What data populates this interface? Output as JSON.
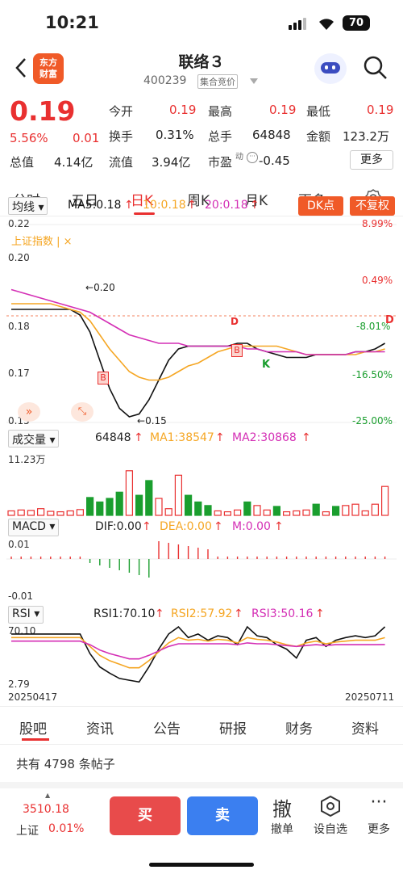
{
  "status": {
    "time": "10:21",
    "battery": "70"
  },
  "header": {
    "logo_line1": "东方",
    "logo_line2": "财富",
    "title": "联络３",
    "code": "400239",
    "auction_tag": "集合竞价"
  },
  "quote": {
    "price": "0.19",
    "pct": "5.56%",
    "change": "0.01",
    "open_lbl": "今开",
    "open": "0.19",
    "high_lbl": "最高",
    "high": "0.19",
    "low_lbl": "最低",
    "low": "0.19",
    "turnover_lbl": "换手",
    "turnover": "0.31%",
    "vol_lbl": "总手",
    "vol": "64848",
    "amount_lbl": "金额",
    "amount": "123.2万",
    "mcap_lbl": "总值",
    "mcap": "4.14亿",
    "float_lbl": "流值",
    "float": "3.94亿",
    "pe_lbl": "市盈",
    "pe_sup": "动",
    "pe": "-0.45",
    "more": "更多"
  },
  "tabs": [
    "分时",
    "五日",
    "日K",
    "周K",
    "月K",
    "更多"
  ],
  "kline": {
    "indicator": "均线",
    "ma5": "MA5:0.18",
    "ma10": "10:0.18",
    "ma20": "20:0.18",
    "dk_btn": "DK点",
    "fq_btn": "不复权",
    "overlay": "上证指数",
    "overlay_close": "×",
    "y_left": [
      "0.22",
      "0.20",
      "0.18",
      "0.17",
      "0.15"
    ],
    "y_right": [
      "8.99%",
      "0.49%",
      "-8.01%",
      "-16.50%",
      "-25.00%"
    ],
    "max_lbl": "0.20",
    "min_lbl": "0.15",
    "marker_b": "B",
    "marker_d": "D",
    "marker_k": "K",
    "right_d": "D"
  },
  "volume": {
    "indicator": "成交量",
    "vol": "64848",
    "ma1": "MA1:38547",
    "ma2": "MA2:30868",
    "ymax": "11.23万"
  },
  "macd": {
    "indicator": "MACD",
    "dif": "DIF:0.00",
    "dea": "DEA:0.00",
    "m": "M:0.00",
    "ymax": "0.01",
    "ymin": "-0.01"
  },
  "rsi": {
    "indicator": "RSI",
    "rsi1": "RSI1:70.10",
    "rsi2": "RSI2:57.92",
    "rsi3": "RSI3:50.16",
    "ymax": "70.10",
    "ymin": "2.79",
    "date_start": "20250417",
    "date_end": "20250711"
  },
  "bottom_tabs": [
    "股吧",
    "资讯",
    "公告",
    "研报",
    "财务",
    "资料"
  ],
  "posts": "共有 4798 条帖子",
  "index": {
    "value": "3510.18",
    "name": "上证",
    "pct": "0.01%"
  },
  "actions": {
    "buy": "买",
    "sell": "卖",
    "cancel_icon": "撤",
    "cancel": "撤单",
    "watch": "设自选",
    "more": "更多"
  },
  "colors": {
    "up": "#e93030",
    "down": "#1a9e2e",
    "ma5": "#111111",
    "ma10": "#f5a623",
    "ma20": "#d42fb5",
    "accent": "#f05a28",
    "buy": "#e84b4b",
    "sell": "#3b7ff0"
  },
  "chart_data": [
    {
      "type": "candlestick",
      "title": "日K",
      "ylim": [
        0.15,
        0.22
      ],
      "series": [
        {
          "name": "MA5",
          "values": [
            0.19,
            0.19,
            0.19,
            0.19,
            0.19,
            0.19,
            0.19,
            0.188,
            0.182,
            0.172,
            0.162,
            0.155,
            0.152,
            0.153,
            0.158,
            0.165,
            0.172,
            0.176,
            0.177,
            0.177,
            0.177,
            0.177,
            0.177,
            0.178,
            0.178,
            0.176,
            0.175,
            0.174,
            0.173,
            0.173,
            0.173,
            0.174,
            0.174,
            0.174,
            0.174,
            0.175,
            0.175,
            0.176,
            0.178
          ]
        },
        {
          "name": "10",
          "values": [
            0.192,
            0.192,
            0.192,
            0.192,
            0.192,
            0.191,
            0.19,
            0.189,
            0.186,
            0.181,
            0.176,
            0.172,
            0.168,
            0.166,
            0.165,
            0.165,
            0.166,
            0.168,
            0.17,
            0.171,
            0.173,
            0.175,
            0.176,
            0.177,
            0.177,
            0.177,
            0.177,
            0.177,
            0.176,
            0.175,
            0.174,
            0.174,
            0.174,
            0.174,
            0.174,
            0.174,
            0.175,
            0.175,
            0.176
          ]
        },
        {
          "name": "20",
          "values": [
            0.197,
            0.196,
            0.195,
            0.194,
            0.193,
            0.192,
            0.191,
            0.19,
            0.189,
            0.187,
            0.185,
            0.183,
            0.181,
            0.18,
            0.179,
            0.178,
            0.178,
            0.178,
            0.177,
            0.177,
            0.177,
            0.177,
            0.177,
            0.177,
            0.176,
            0.176,
            0.175,
            0.175,
            0.175,
            0.175,
            0.174,
            0.174,
            0.174,
            0.174,
            0.174,
            0.175,
            0.175,
            0.175,
            0.175
          ]
        }
      ]
    },
    {
      "type": "bar",
      "title": "成交量",
      "ylim": [
        0,
        112300
      ],
      "values": [
        10000,
        12000,
        11000,
        15000,
        9000,
        8000,
        10000,
        13000,
        40000,
        30000,
        38000,
        52000,
        100000,
        45000,
        78000,
        38000,
        15000,
        90000,
        45000,
        30000,
        22000,
        10000,
        8000,
        12000,
        30000,
        22000,
        12000,
        20000,
        8000,
        10000,
        12000,
        25000,
        8000,
        20000,
        22000,
        25000,
        10000,
        25000,
        64848
      ]
    },
    {
      "type": "bar",
      "title": "MACD",
      "ylim": [
        -0.01,
        0.01
      ]
    },
    {
      "type": "line",
      "title": "RSI",
      "x": [
        "20250417",
        "20250711"
      ],
      "ylim": [
        2.79,
        70.1
      ],
      "series": [
        {
          "name": "RSI1",
          "values": [
            62,
            62,
            62,
            62,
            62,
            62,
            62,
            62,
            40,
            25,
            18,
            12,
            10,
            8,
            25,
            45,
            62,
            70,
            58,
            62,
            55,
            60,
            58,
            50,
            72,
            60,
            58,
            50,
            45,
            35,
            55,
            58,
            48,
            55,
            58,
            60,
            58,
            60,
            70.1
          ]
        },
        {
          "name": "RSI2",
          "values": [
            58,
            58,
            58,
            58,
            58,
            58,
            58,
            58,
            48,
            38,
            32,
            28,
            24,
            24,
            32,
            42,
            52,
            58,
            55,
            56,
            54,
            56,
            55,
            52,
            58,
            56,
            55,
            53,
            50,
            48,
            52,
            54,
            51,
            53,
            54,
            55,
            55,
            55,
            57.92
          ]
        },
        {
          "name": "RSI3",
          "values": [
            54,
            54,
            54,
            54,
            54,
            54,
            54,
            54,
            50,
            44,
            40,
            37,
            34,
            34,
            38,
            43,
            48,
            51,
            51,
            51,
            51,
            51,
            51,
            50,
            52,
            51,
            51,
            50,
            49,
            48,
            49,
            50,
            49,
            50,
            50,
            50,
            50,
            50,
            50.16
          ]
        }
      ]
    }
  ]
}
